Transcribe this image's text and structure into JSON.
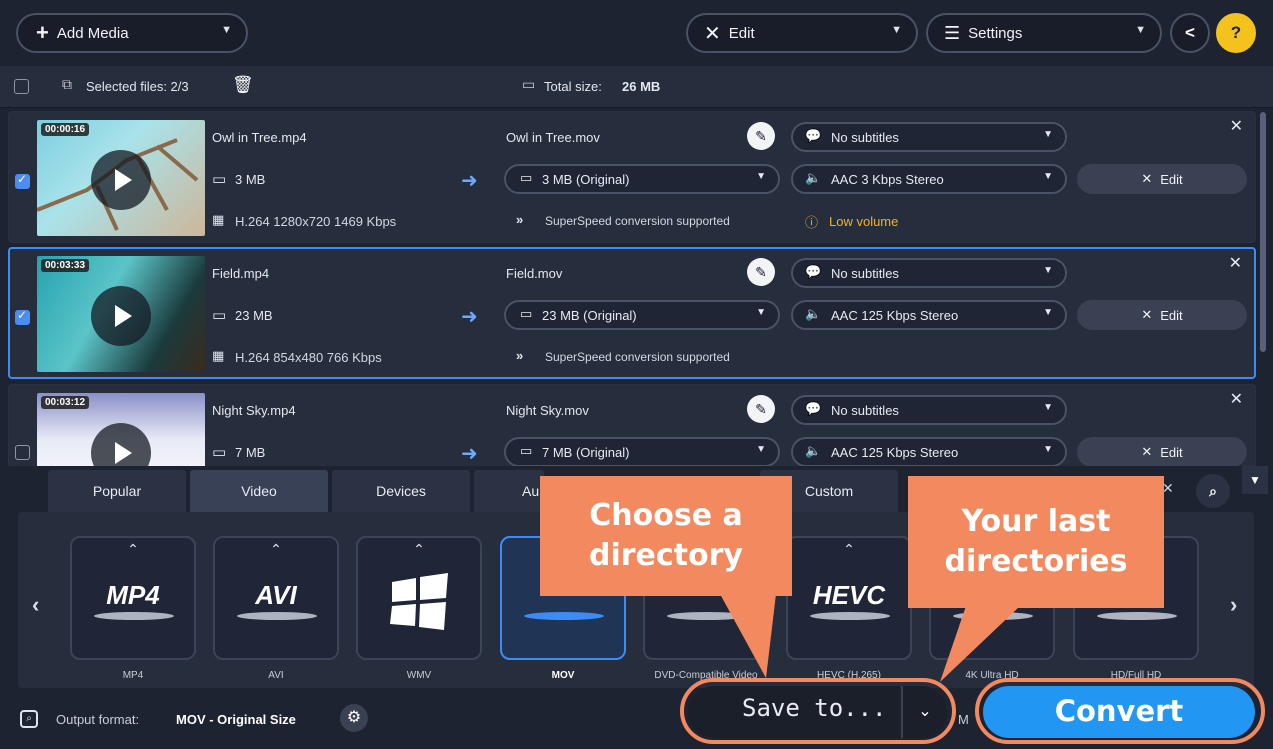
{
  "toolbar": {
    "add_media": "Add Media",
    "edit": "Edit",
    "settings": "Settings"
  },
  "selection": {
    "selected_files": "Selected files: 2/3",
    "total_label": "Total size:",
    "total_value": "26 MB"
  },
  "files": [
    {
      "duration": "00:00:16",
      "name": "Owl in Tree.mp4",
      "size": "3 MB",
      "codec": "H.264 1280x720 1469 Kbps",
      "output_name": "Owl in Tree.mov",
      "output_size": "3 MB (Original)",
      "superspeed": "SuperSpeed conversion supported",
      "subtitles": "No subtitles",
      "audio": "AAC 3 Kbps Stereo",
      "warning": "Low volume",
      "edit": "Edit",
      "checked": true
    },
    {
      "duration": "00:03:33",
      "name": "Field.mp4",
      "size": "23 MB",
      "codec": "H.264 854x480 766 Kbps",
      "output_name": "Field.mov",
      "output_size": "23 MB (Original)",
      "superspeed": "SuperSpeed conversion supported",
      "subtitles": "No subtitles",
      "audio": "AAC 125 Kbps Stereo",
      "edit": "Edit",
      "checked": true
    },
    {
      "duration": "00:03:12",
      "name": "Night Sky.mp4",
      "size": "7 MB",
      "output_name": "Night Sky.mov",
      "output_size": "7 MB (Original)",
      "subtitles": "No subtitles",
      "audio": "AAC 125 Kbps Stereo",
      "edit": "Edit",
      "checked": false
    }
  ],
  "tabs": [
    "Popular",
    "Video",
    "Devices",
    "Au",
    "Custom"
  ],
  "formats": [
    {
      "big": "MP4",
      "label": "MP4"
    },
    {
      "big": "AVI",
      "label": "AVI"
    },
    {
      "big": "",
      "label": "WMV"
    },
    {
      "big": "",
      "label": "MOV"
    },
    {
      "big": "",
      "label": "DVD-Compatible Video"
    },
    {
      "big": "HEVC",
      "label": "HEVC (H.265)"
    },
    {
      "big": "",
      "label": "4K Ultra HD"
    },
    {
      "big": "",
      "label": "HD/Full HD"
    }
  ],
  "output": {
    "label": "Output format:",
    "value": "MOV - Original Size"
  },
  "save_to": "Save to...",
  "convert": "Convert",
  "callouts": {
    "choose_directory": "Choose a directory",
    "last_directories": "Your last directories"
  },
  "colors": {
    "accent": "#3d8bf5",
    "callout": "#f3895f",
    "warning": "#f0b22a",
    "background": "#1d2331"
  }
}
